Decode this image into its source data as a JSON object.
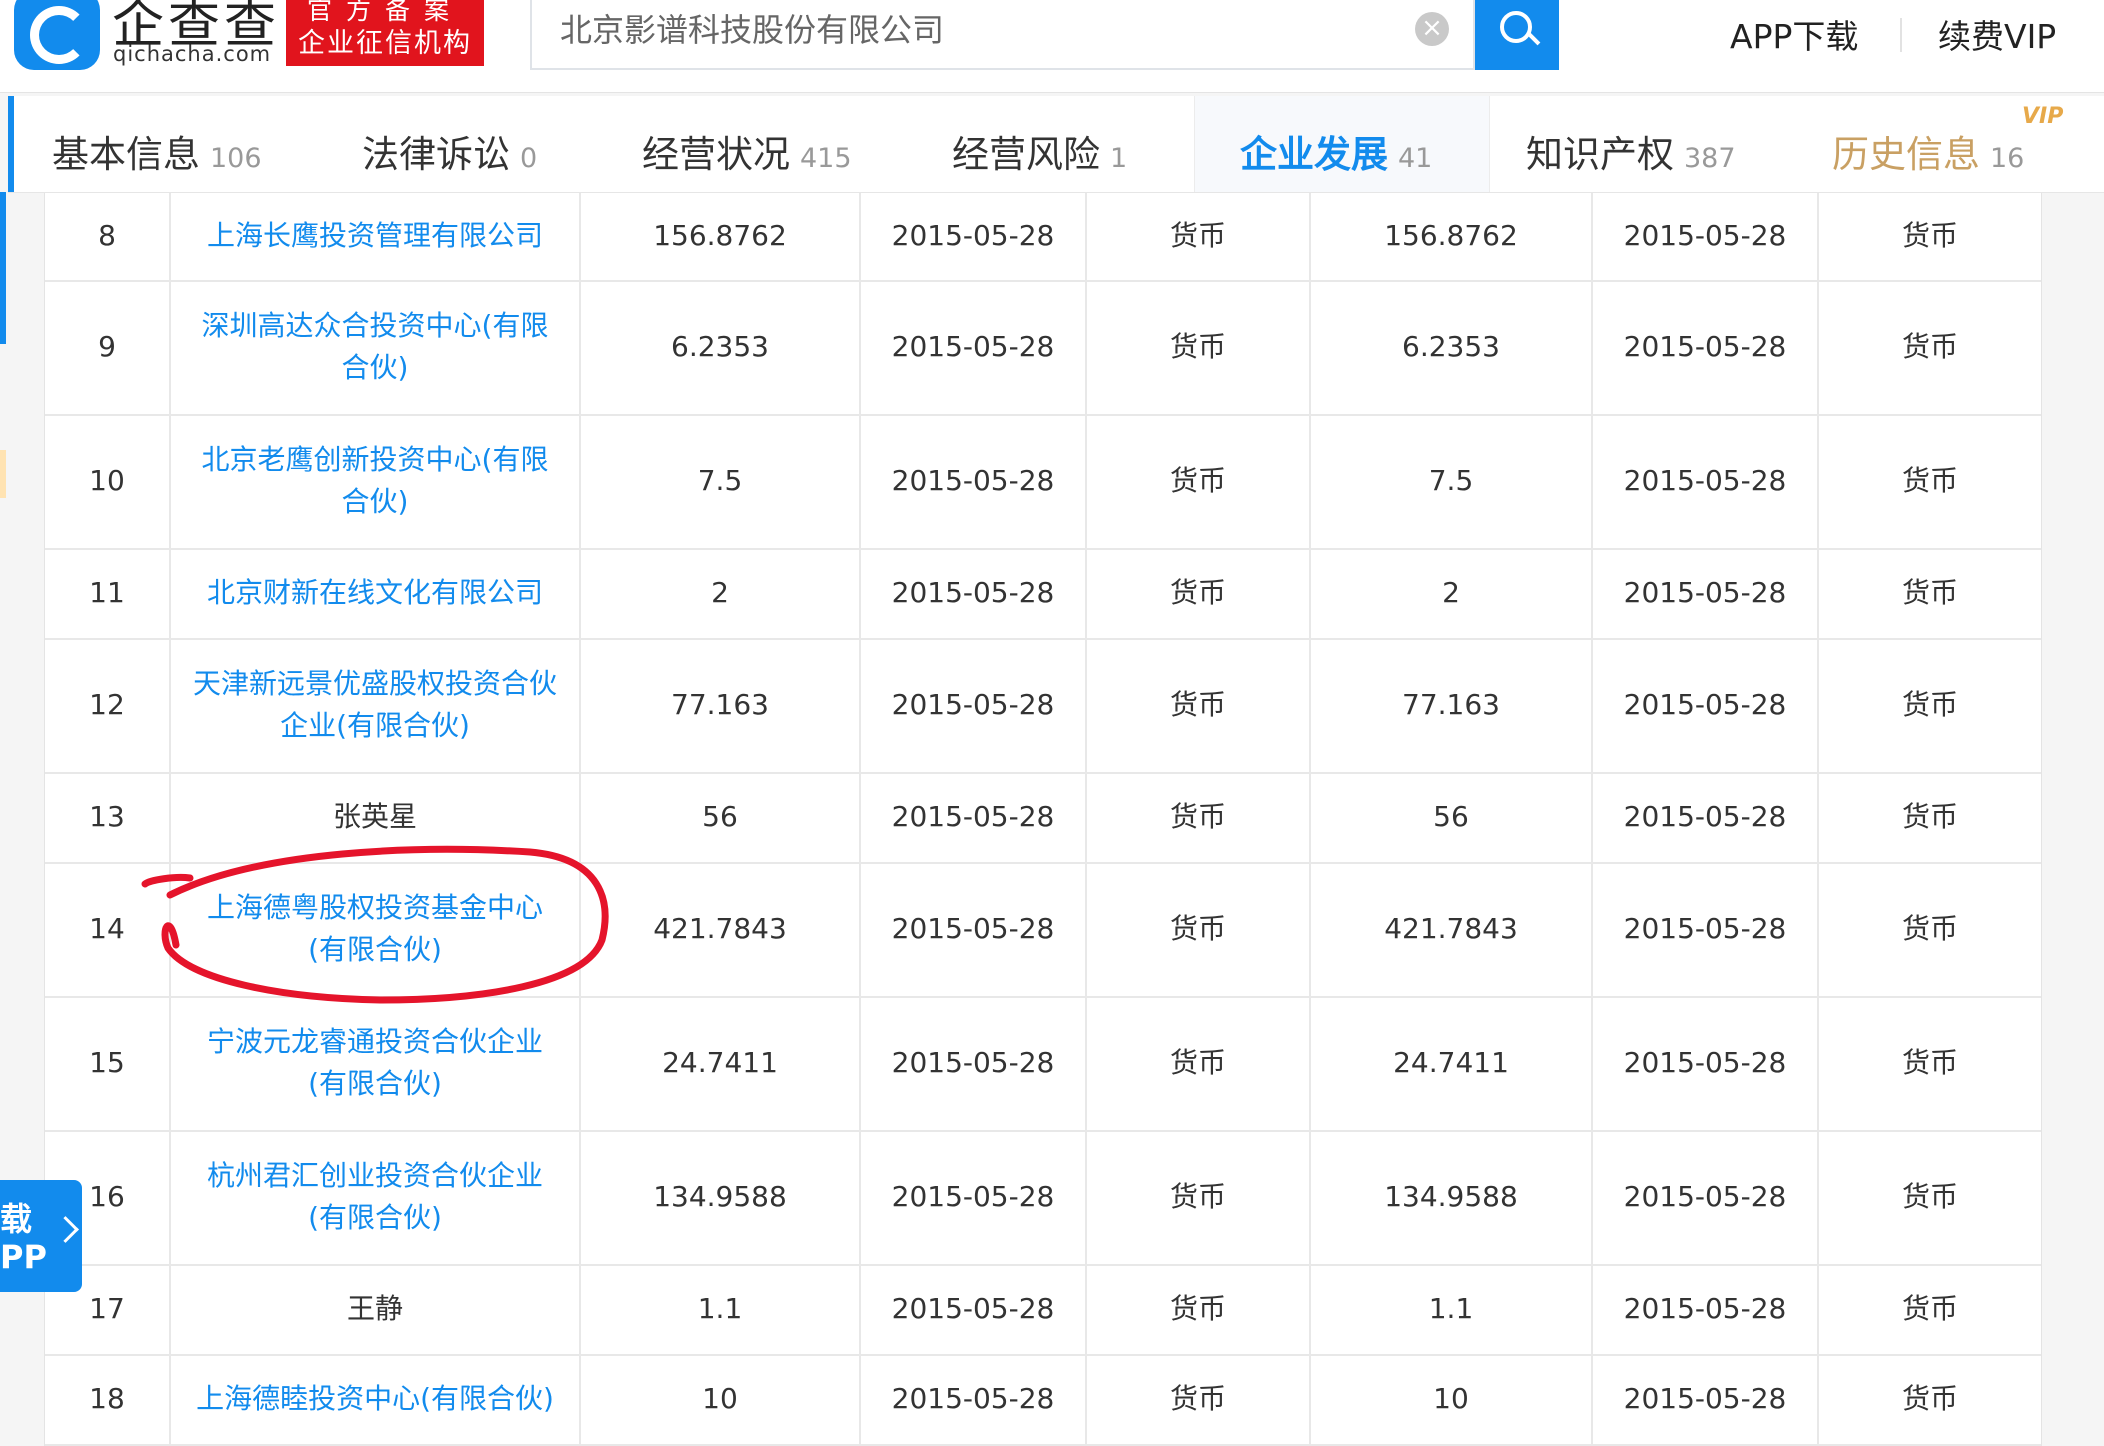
{
  "header": {
    "brand_name": "企查查",
    "brand_url": "qichacha.com",
    "badge_top": "官方备案",
    "badge_bottom": "企业征信机构",
    "search_value": "北京影谱科技股份有限公司",
    "app_download": "APP下载",
    "renew_vip": "续费VIP"
  },
  "tabs": [
    {
      "label": "基本信息",
      "count": "106"
    },
    {
      "label": "法律诉讼",
      "count": "0"
    },
    {
      "label": "经营状况",
      "count": "415"
    },
    {
      "label": "经营风险",
      "count": "1"
    },
    {
      "label": "企业发展",
      "count": "41"
    },
    {
      "label": "知识产权",
      "count": "387"
    },
    {
      "label": "历史信息",
      "count": "16"
    }
  ],
  "vip_mark": "VIP",
  "table": {
    "rows": [
      {
        "no": "8",
        "name": "上海长鹰投资管理有限公司",
        "subscribed": "156.8762",
        "sub_date": "2015-05-28",
        "sub_method": "货币",
        "paid": "156.8762",
        "paid_date": "2015-05-28",
        "paid_method": "货币"
      },
      {
        "no": "9",
        "name": "深圳高达众合投资中心(有限合伙)",
        "subscribed": "6.2353",
        "sub_date": "2015-05-28",
        "sub_method": "货币",
        "paid": "6.2353",
        "paid_date": "2015-05-28",
        "paid_method": "货币"
      },
      {
        "no": "10",
        "name": "北京老鹰创新投资中心(有限合伙)",
        "subscribed": "7.5",
        "sub_date": "2015-05-28",
        "sub_method": "货币",
        "paid": "7.5",
        "paid_date": "2015-05-28",
        "paid_method": "货币"
      },
      {
        "no": "11",
        "name": "北京财新在线文化有限公司",
        "subscribed": "2",
        "sub_date": "2015-05-28",
        "sub_method": "货币",
        "paid": "2",
        "paid_date": "2015-05-28",
        "paid_method": "货币"
      },
      {
        "no": "12",
        "name": "天津新远景优盛股权投资合伙企业(有限合伙)",
        "subscribed": "77.163",
        "sub_date": "2015-05-28",
        "sub_method": "货币",
        "paid": "77.163",
        "paid_date": "2015-05-28",
        "paid_method": "货币"
      },
      {
        "no": "13",
        "name": "张英星",
        "subscribed": "56",
        "sub_date": "2015-05-28",
        "sub_method": "货币",
        "paid": "56",
        "paid_date": "2015-05-28",
        "paid_method": "货币"
      },
      {
        "no": "14",
        "name": "上海德粤股权投资基金中心(有限合伙)",
        "subscribed": "421.7843",
        "sub_date": "2015-05-28",
        "sub_method": "货币",
        "paid": "421.7843",
        "paid_date": "2015-05-28",
        "paid_method": "货币"
      },
      {
        "no": "15",
        "name": "宁波元龙睿通投资合伙企业(有限合伙)",
        "subscribed": "24.7411",
        "sub_date": "2015-05-28",
        "sub_method": "货币",
        "paid": "24.7411",
        "paid_date": "2015-05-28",
        "paid_method": "货币"
      },
      {
        "no": "16",
        "name": "杭州君汇创业投资合伙企业(有限合伙)",
        "subscribed": "134.9588",
        "sub_date": "2015-05-28",
        "sub_method": "货币",
        "paid": "134.9588",
        "paid_date": "2015-05-28",
        "paid_method": "货币"
      },
      {
        "no": "17",
        "name": "王静",
        "subscribed": "1.1",
        "sub_date": "2015-05-28",
        "sub_method": "货币",
        "paid": "1.1",
        "paid_date": "2015-05-28",
        "paid_method": "货币"
      },
      {
        "no": "18",
        "name": "上海德睦投资中心(有限合伙)",
        "subscribed": "10",
        "sub_date": "2015-05-28",
        "sub_method": "货币",
        "paid": "10",
        "paid_date": "2015-05-28",
        "paid_method": "货币"
      }
    ]
  },
  "float_app": {
    "line1": "载",
    "line2": "PP"
  },
  "colors": {
    "brand_blue": "#128bed",
    "badge_red": "#e1141d",
    "vip_gold": "#c9a063",
    "annotation_red": "#e5142b"
  }
}
